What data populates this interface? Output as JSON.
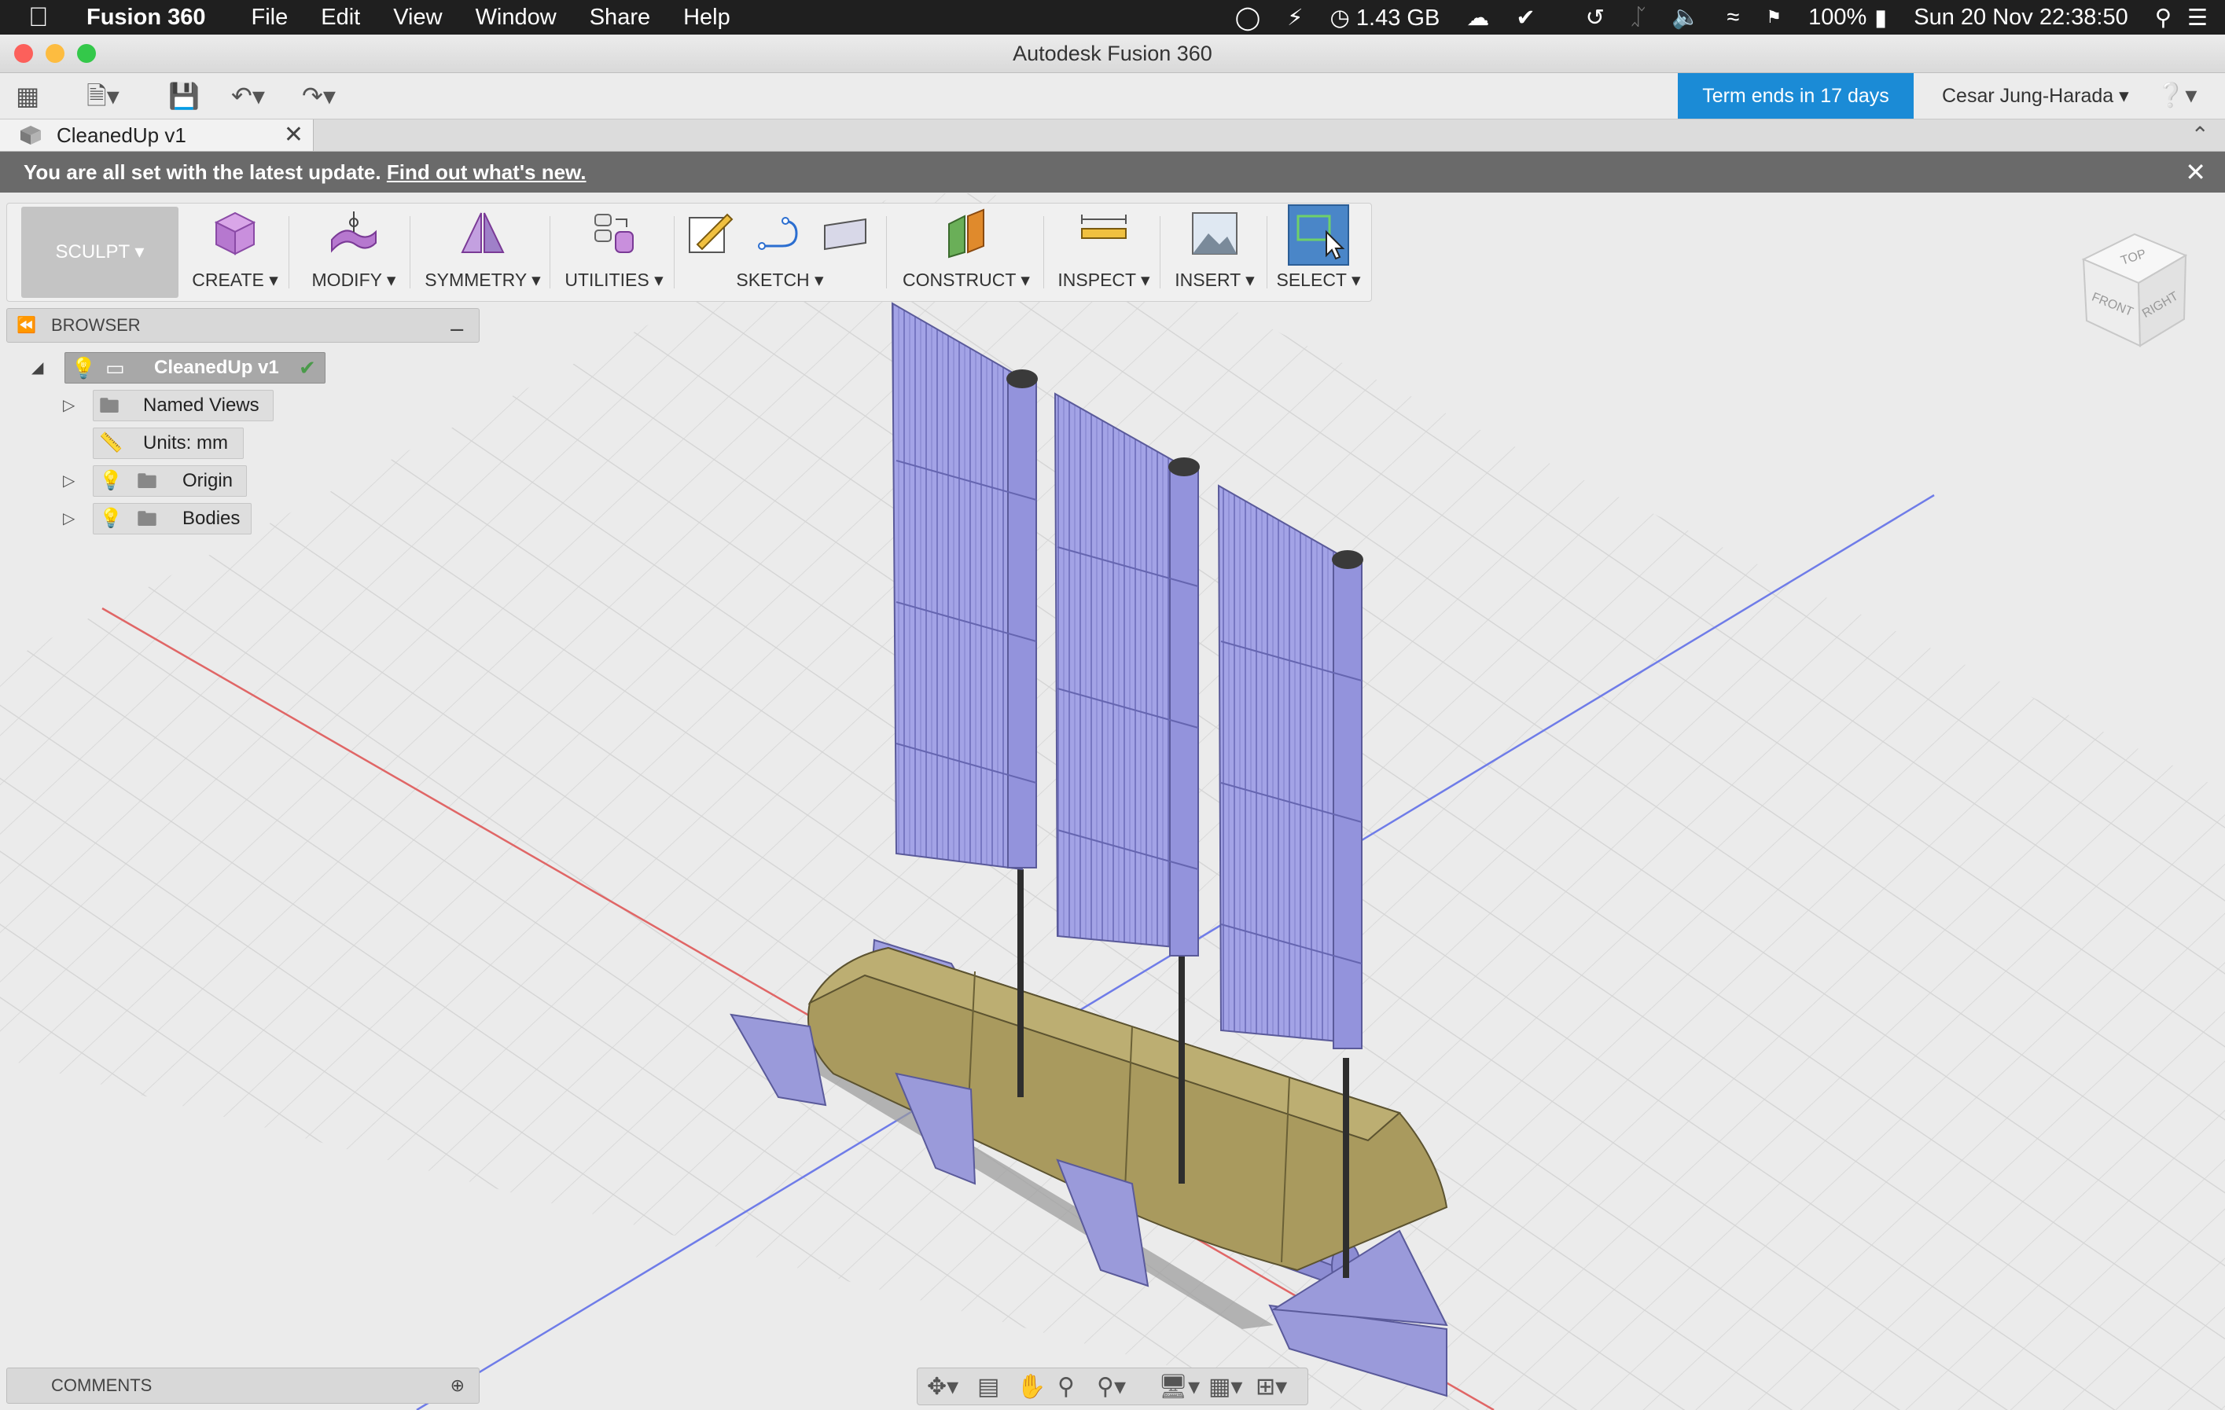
{
  "menubar": {
    "app": "Fusion 360",
    "items": [
      "File",
      "Edit",
      "View",
      "Window",
      "Share",
      "Help"
    ],
    "memory": "1.43 GB",
    "battery": "100%",
    "datetime": "Sun 20 Nov  22:38:50"
  },
  "window": {
    "title": "Autodesk Fusion 360"
  },
  "toolbar": {
    "term_notice": "Term ends in 17 days",
    "user": "Cesar Jung-Harada"
  },
  "document_tab": {
    "label": "CleanedUp v1"
  },
  "notification": {
    "message": "You are all set with the latest update.",
    "link": "Find out what's new."
  },
  "ribbon": {
    "workspace": "SCULPT",
    "groups": [
      {
        "label": "CREATE"
      },
      {
        "label": "MODIFY"
      },
      {
        "label": "SYMMETRY"
      },
      {
        "label": "UTILITIES"
      },
      {
        "label": "SKETCH"
      },
      {
        "label": "CONSTRUCT"
      },
      {
        "label": "INSPECT"
      },
      {
        "label": "INSERT"
      },
      {
        "label": "SELECT"
      }
    ]
  },
  "browser": {
    "title": "BROWSER",
    "root": "CleanedUp v1",
    "items": [
      {
        "label": "Named Views"
      },
      {
        "label": "Units: mm"
      },
      {
        "label": "Origin"
      },
      {
        "label": "Bodies"
      }
    ]
  },
  "comments": {
    "title": "COMMENTS"
  },
  "viewcube": {
    "top": "TOP",
    "front": "FRONT",
    "right": "RIGHT"
  },
  "colors": {
    "accent": "#1b8bd6",
    "sail": "#9a9ae0",
    "hull": "#a99a5e",
    "x_axis": "#e06666",
    "z_axis": "#6f7ce8"
  }
}
